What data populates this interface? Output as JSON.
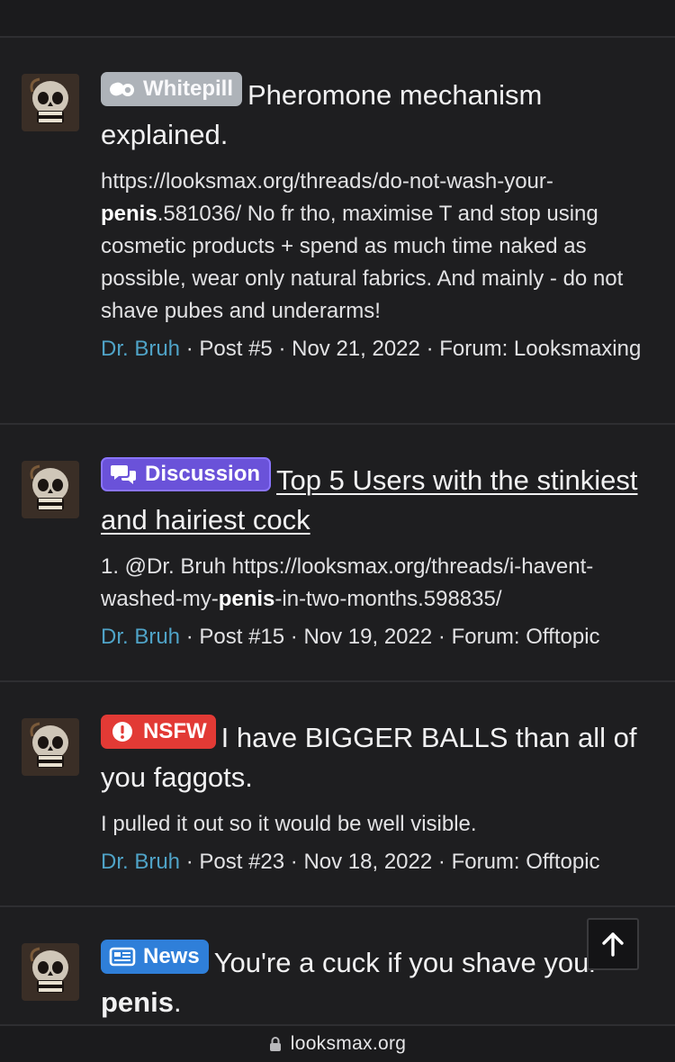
{
  "results": [
    {
      "prefix": {
        "label": "Whitepill",
        "icon": "pills-icon",
        "color": "#aeb3b9"
      },
      "title": "Pheromone mechanism explained.",
      "snippet_parts": [
        "https://looksmax.org/threads/do-not-wash-your-",
        "penis",
        ".581036/ No fr tho, maximise T and stop using cosmetic products + spend as much time naked as possible, wear only natural fabrics. And mainly - do not shave pubes and underarms!"
      ],
      "author": "Dr. Bruh",
      "post": "Post #5",
      "date": "Nov 21, 2022",
      "forum_label": "Forum:",
      "forum": "Looksmaxing"
    },
    {
      "prefix": {
        "label": "Discussion",
        "icon": "chat-bubbles-icon",
        "color": "#6a52d9"
      },
      "title": "Top 5 Users with the stinkiest and hairiest cock",
      "snippet_parts": [
        "1. @Dr. Bruh https://looksmax.org/threads/i-havent-washed-my-",
        "penis",
        "-in-two-months.598835/"
      ],
      "author": "Dr. Bruh",
      "post": "Post #15",
      "date": "Nov 19, 2022",
      "forum_label": "Forum:",
      "forum": "Offtopic"
    },
    {
      "prefix": {
        "label": "NSFW",
        "icon": "exclamation-circle-icon",
        "color": "#e23a35"
      },
      "title": "I have BIGGER BALLS than all of you faggots.",
      "snippet": "I pulled it out so it would be well visible.",
      "author": "Dr. Bruh",
      "post": "Post #23",
      "date": "Nov 18, 2022",
      "forum_label": "Forum:",
      "forum": "Offtopic"
    },
    {
      "prefix": {
        "label": "News",
        "icon": "newspaper-icon",
        "color": "#2f7fd9"
      },
      "title_parts": [
        "You're a cuck if you shave your ",
        "penis",
        "."
      ]
    }
  ],
  "separator": "·",
  "scroll_top": {
    "icon": "arrow-up-icon"
  },
  "browser": {
    "url": "looksmax.org",
    "icon": "lock-icon"
  }
}
